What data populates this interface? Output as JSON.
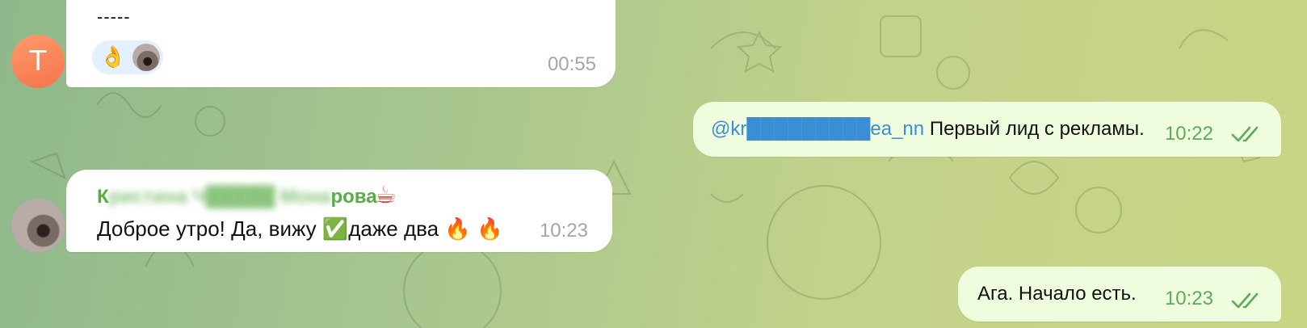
{
  "colors": {
    "outgoing_bubble": "#effdde",
    "incoming_bubble": "#ffffff",
    "sender_name": "#5aac47",
    "mention": "#3b8ed6",
    "read_check": "#5cab5a"
  },
  "messages": [
    {
      "direction": "incoming",
      "avatar_letter": "T",
      "text": "-----",
      "reaction": {
        "emoji": "👌",
        "icon": "ok-hand-emoji"
      },
      "time": "00:55"
    },
    {
      "direction": "outgoing",
      "mention": "@kr█████████ea_nn",
      "text": "Первый лид с рекламы.",
      "time": "10:22",
      "status_icon": "double-check-icon"
    },
    {
      "direction": "incoming",
      "sender_visible_start": "К",
      "sender_blurred": "ристина Ч█████ Мона",
      "sender_visible_end": "рова",
      "sender_emoji": "☕",
      "text_start": "Доброе утро! Да, вижу ",
      "ok_emoji": "✅",
      "text_mid": "даже два ",
      "fire_emoji_1": "🔥",
      "fire_emoji_2": "🔥",
      "time": "10:23"
    },
    {
      "direction": "outgoing",
      "text": "Ага. Начало есть.",
      "time": "10:23",
      "status_icon": "double-check-icon"
    }
  ]
}
